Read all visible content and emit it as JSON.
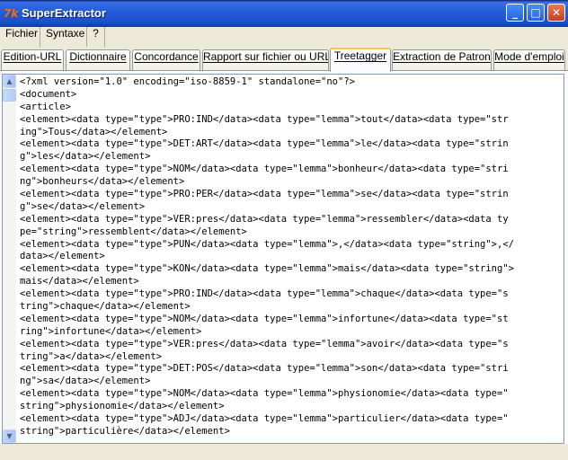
{
  "window": {
    "title": "SuperExtractor",
    "icon": "tk-feather-icon",
    "controls": {
      "minimize": "_",
      "maximize": "□",
      "close": "✕"
    }
  },
  "menu": {
    "items": [
      "Fichier",
      "Syntaxe",
      "?"
    ]
  },
  "tabs": [
    {
      "label": "Edition-URL"
    },
    {
      "label": "Dictionnaire"
    },
    {
      "label": "Concordance"
    },
    {
      "label": "Rapport sur fichier ou URL"
    },
    {
      "label": "Treetagger",
      "active": true
    },
    {
      "label": "Extraction de Patron"
    },
    {
      "label": "Mode d'emploi"
    }
  ],
  "scrollbar": {
    "up": "▲",
    "down": "▼"
  },
  "editor": {
    "lines": [
      "<?xml version=\"1.0\" encoding=\"iso-8859-1\" standalone=\"no\"?>",
      "<document>",
      "<article>",
      "<element><data type=\"type\">PRO:IND</data><data type=\"lemma\">tout</data><data type=\"str",
      "ing\">Tous</data></element>",
      "<element><data type=\"type\">DET:ART</data><data type=\"lemma\">le</data><data type=\"strin",
      "g\">les</data></element>",
      "<element><data type=\"type\">NOM</data><data type=\"lemma\">bonheur</data><data type=\"stri",
      "ng\">bonheurs</data></element>",
      "<element><data type=\"type\">PRO:PER</data><data type=\"lemma\">se</data><data type=\"strin",
      "g\">se</data></element>",
      "<element><data type=\"type\">VER:pres</data><data type=\"lemma\">ressembler</data><data ty",
      "pe=\"string\">ressemblent</data></element>",
      "<element><data type=\"type\">PUN</data><data type=\"lemma\">,</data><data type=\"string\">,</",
      "data></element>",
      "<element><data type=\"type\">KON</data><data type=\"lemma\">mais</data><data type=\"string\">",
      "mais</data></element>",
      "<element><data type=\"type\">PRO:IND</data><data type=\"lemma\">chaque</data><data type=\"s",
      "tring\">chaque</data></element>",
      "<element><data type=\"type\">NOM</data><data type=\"lemma\">infortune</data><data type=\"st",
      "ring\">infortune</data></element>",
      "<element><data type=\"type\">VER:pres</data><data type=\"lemma\">avoir</data><data type=\"s",
      "tring\">a</data></element>",
      "<element><data type=\"type\">DET:POS</data><data type=\"lemma\">son</data><data type=\"stri",
      "ng\">sa</data></element>",
      "<element><data type=\"type\">NOM</data><data type=\"lemma\">physionomie</data><data type=\"",
      "string\">physionomie</data></element>",
      "<element><data type=\"type\">ADJ</data><data type=\"lemma\">particulier</data><data type=\"",
      "string\">particulière</data></element>"
    ]
  }
}
